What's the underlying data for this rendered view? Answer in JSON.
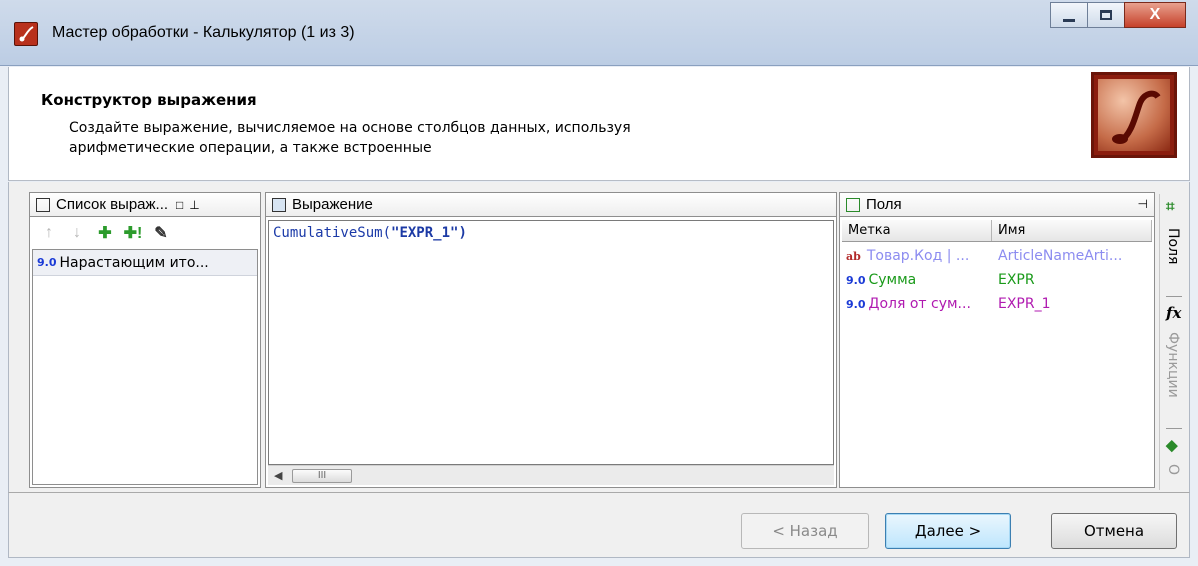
{
  "window": {
    "title": "Мастер обработки - Калькулятор (1 из 3)",
    "close_label": "X"
  },
  "header": {
    "title": "Конструктор выражения",
    "description": "Создайте выражение, вычисляемое на основе столбцов данных, используя арифметические операции, а также встроенные"
  },
  "expression_list": {
    "title": "Список выраж...",
    "items": [
      {
        "type": "9.0",
        "label": "Нарастающим ито..."
      }
    ]
  },
  "expression": {
    "title": "Выражение",
    "code_fn": "CumulativeSum(",
    "code_arg": "\"EXPR_1\"",
    "code_close": ")",
    "scroll_glyph": "III"
  },
  "fields": {
    "title": "Поля",
    "columns": [
      "Метка",
      "Имя"
    ],
    "rows": [
      {
        "type": "ab",
        "label": "Товар.Код | ...",
        "name": "ArticleNameArti...",
        "color": "#8c8cf0"
      },
      {
        "type": "9.0",
        "label": "Сумма",
        "name": "EXPR",
        "color": "#1a9a1a"
      },
      {
        "type": "9.0",
        "label": "Доля от сум...",
        "name": "EXPR_1",
        "color": "#b01ab0"
      }
    ]
  },
  "side_tabs": {
    "fields_tab": "Поля",
    "functions_tab": "Функции",
    "other_tab": "О"
  },
  "footer": {
    "back_label": "< Назад",
    "next_label": "Далее >",
    "cancel_label": "Отмена"
  }
}
